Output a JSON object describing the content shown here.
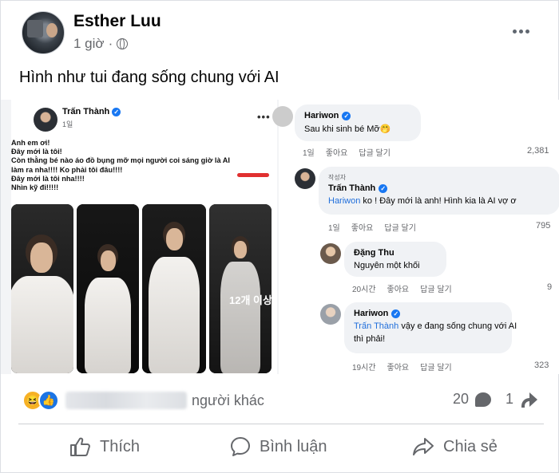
{
  "post": {
    "author": "Esther Luu",
    "time": "1 giờ",
    "separator": "·",
    "text": "Hình như tui đang sống chung với AI"
  },
  "embedded_post": {
    "author": "Trấn Thành",
    "time": "1일",
    "lines": [
      "Anh em ơi!",
      "Đây mới là tôi!",
      "Còn thằng bé nào áo đồ bụng mỡ mọi người coi sáng giờ là AI",
      "làm ra nha!!!! Ko phải tôi đâu!!!!",
      "Đây mới là tôi nha!!!!",
      "Nhìn kỹ đi!!!!!"
    ],
    "more_photos_label": "12개 이상"
  },
  "comments": [
    {
      "name": "Hariwon",
      "verified": true,
      "text": "Sau khi sinh bé Mỡ🤭",
      "time": "1일",
      "like": "좋아요",
      "reply": "답글 달기",
      "count": "2,381"
    },
    {
      "tag": "작성자",
      "name": "Trấn Thành",
      "verified": true,
      "mention": "Hariwon",
      "text": " ko ! Đây mới là anh! Hình kia là AI vợ ơ",
      "time": "1일",
      "like": "좋아요",
      "reply": "답글 달기",
      "count": "795"
    },
    {
      "name": "Đặng Thu",
      "verified": false,
      "text": "Nguyên một khối",
      "time": "20시간",
      "like": "좋아요",
      "reply": "답글 달기",
      "count": "9"
    },
    {
      "name": "Hariwon",
      "verified": true,
      "mention": "Trấn Thành",
      "text": " vậy e đang sống chung với AI",
      "text2": "thì phải!",
      "time": "19시간",
      "like": "좋아요",
      "reply": "답글 달기",
      "count": "323"
    }
  ],
  "reactions": {
    "icons": [
      "haha-icon",
      "like-icon"
    ],
    "label": "người khác",
    "comments_count": "20",
    "shares_count": "1"
  },
  "actions": {
    "like": "Thích",
    "comment": "Bình luận",
    "share": "Chia sẻ"
  },
  "colors": {
    "accent": "#1877f2",
    "text_secondary": "#65676b",
    "highlight_mark": "#e03030"
  }
}
